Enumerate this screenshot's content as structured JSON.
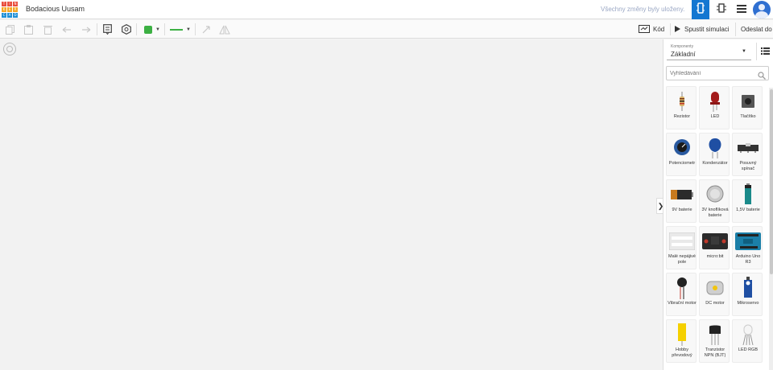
{
  "topbar": {
    "project_title": "Bodacious Uusam",
    "saved_status": "Všechny změny byly uloženy.",
    "logo_letters": [
      "T",
      "I",
      "N",
      "K",
      "E",
      "R",
      "C",
      "A",
      "D"
    ],
    "logo_colors": [
      "#e94e3d",
      "#e94e3d",
      "#e94e3d",
      "#f6a623",
      "#f6a623",
      "#f6a623",
      "#1f8fd6",
      "#1f8fd6",
      "#1f8fd6"
    ],
    "views": [
      {
        "icon": "circuit-view-icon",
        "active": true
      },
      {
        "icon": "schematic-view-icon",
        "active": false
      },
      {
        "icon": "component-list-icon",
        "active": false
      }
    ]
  },
  "toolbar": {
    "tools": [
      "copy-icon",
      "paste-icon",
      "delete-icon",
      "undo-icon",
      "redo-icon",
      "note-icon",
      "notes-visibility-icon"
    ],
    "wire_color": "#3cb043",
    "code_label": "Kód",
    "simulate_label": "Spustit simulaci",
    "export_label": "Odeslat do"
  },
  "panel": {
    "select_caption": "Komponenty",
    "select_value": "Základní",
    "search_placeholder": "Vyhledávání",
    "components": [
      {
        "label": "Rezistor",
        "icon": "resistor"
      },
      {
        "label": "LED",
        "icon": "led"
      },
      {
        "label": "Tlačítko",
        "icon": "pushbutton"
      },
      {
        "label": "Potenciometr",
        "icon": "potentiometer"
      },
      {
        "label": "Kondenzátor",
        "icon": "capacitor"
      },
      {
        "label": "Posuvný spínač",
        "icon": "slide-switch"
      },
      {
        "label": "9V baterie",
        "icon": "battery-9v"
      },
      {
        "label": "3V knoflíková baterie",
        "icon": "coin-battery"
      },
      {
        "label": "1,5V baterie",
        "icon": "battery-aa"
      },
      {
        "label": "Malé nepájivé pole",
        "icon": "breadboard"
      },
      {
        "label": "micro:bit",
        "icon": "microbit"
      },
      {
        "label": "Arduino Uno R3",
        "icon": "arduino"
      },
      {
        "label": "Vibrační motor",
        "icon": "vibration-motor"
      },
      {
        "label": "DC motor",
        "icon": "dc-motor"
      },
      {
        "label": "Mikroservo",
        "icon": "micro-servo"
      },
      {
        "label": "Hobby převodový",
        "icon": "hobby-gearmotor"
      },
      {
        "label": "Tranzistor NPN (BJT)",
        "icon": "npn-transistor"
      },
      {
        "label": "LED RGB",
        "icon": "rgb-led"
      }
    ]
  }
}
